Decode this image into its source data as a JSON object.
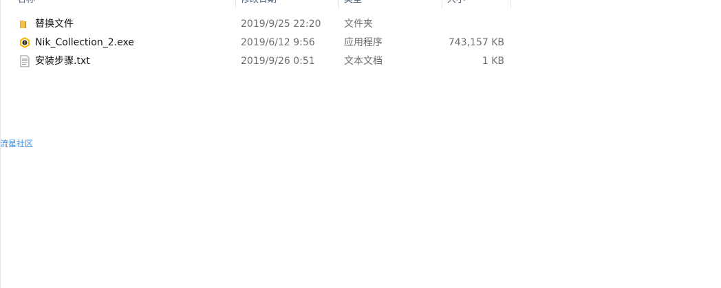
{
  "columns": {
    "name": "名称",
    "date": "修改日期",
    "type": "类型",
    "size": "大小"
  },
  "files": [
    {
      "icon": "folder-icon",
      "name": "替换文件",
      "date": "2019/9/25 22:20",
      "type": "文件夹",
      "size": ""
    },
    {
      "icon": "exe-icon",
      "name": "Nik_Collection_2.exe",
      "date": "2019/6/12 9:56",
      "type": "应用程序",
      "size": "743,157 KB"
    },
    {
      "icon": "text-file-icon",
      "name": "安装步骤.txt",
      "date": "2019/9/26 0:51",
      "type": "文本文档",
      "size": "1 KB"
    }
  ],
  "watermark": "流星社区",
  "colors": {
    "folder": "#f5c24c",
    "exe_ring": "#f2b705",
    "exe_core": "#2b2b2b",
    "watermark": "#3a8ee6"
  }
}
